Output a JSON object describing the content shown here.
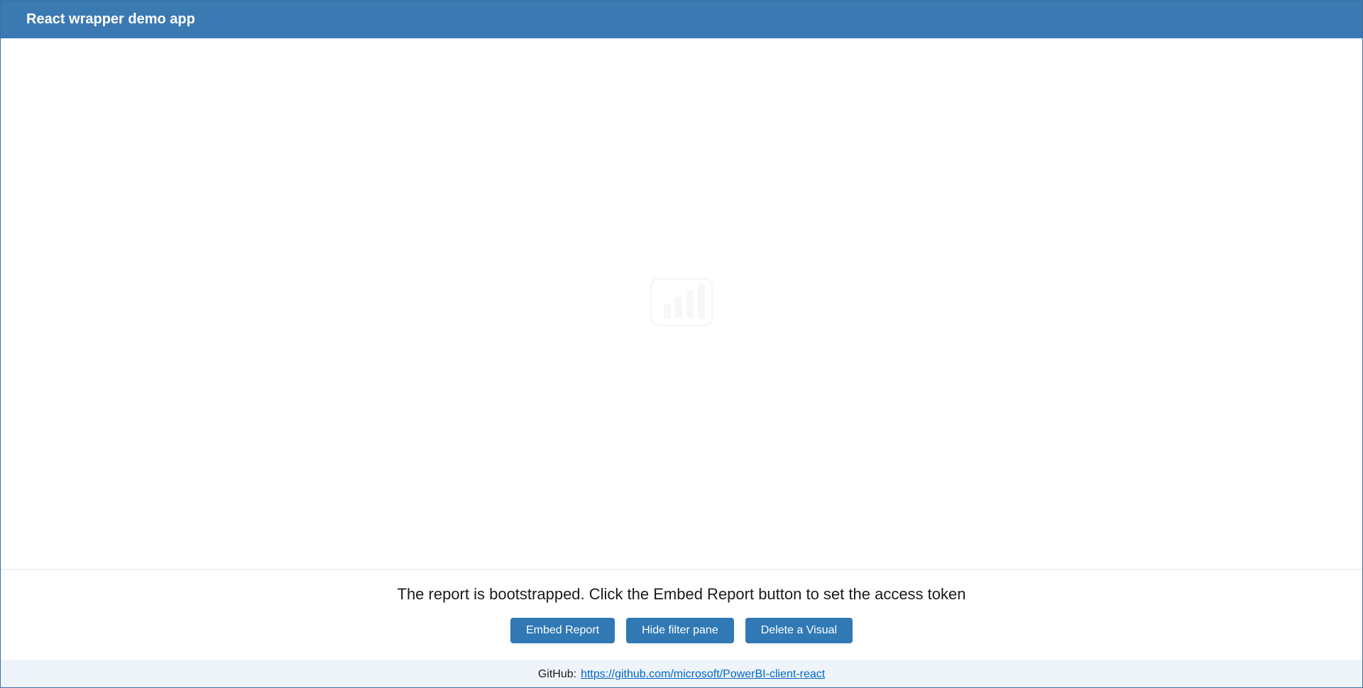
{
  "header": {
    "title": "React wrapper demo app"
  },
  "embed": {
    "placeholder_icon": "powerbi-logo-icon"
  },
  "controls": {
    "status_message": "The report is bootstrapped. Click the Embed Report button to set the access token",
    "buttons": {
      "embed_report": "Embed Report",
      "hide_filter_pane": "Hide filter pane",
      "delete_visual": "Delete a Visual"
    }
  },
  "footer": {
    "label": "GitHub:",
    "link_text": "https://github.com/microsoft/PowerBI-client-react"
  },
  "colors": {
    "header_bg": "#3b79b3",
    "button_bg": "#3079b5",
    "footer_bg": "#eef4f9",
    "link": "#0066cc"
  }
}
